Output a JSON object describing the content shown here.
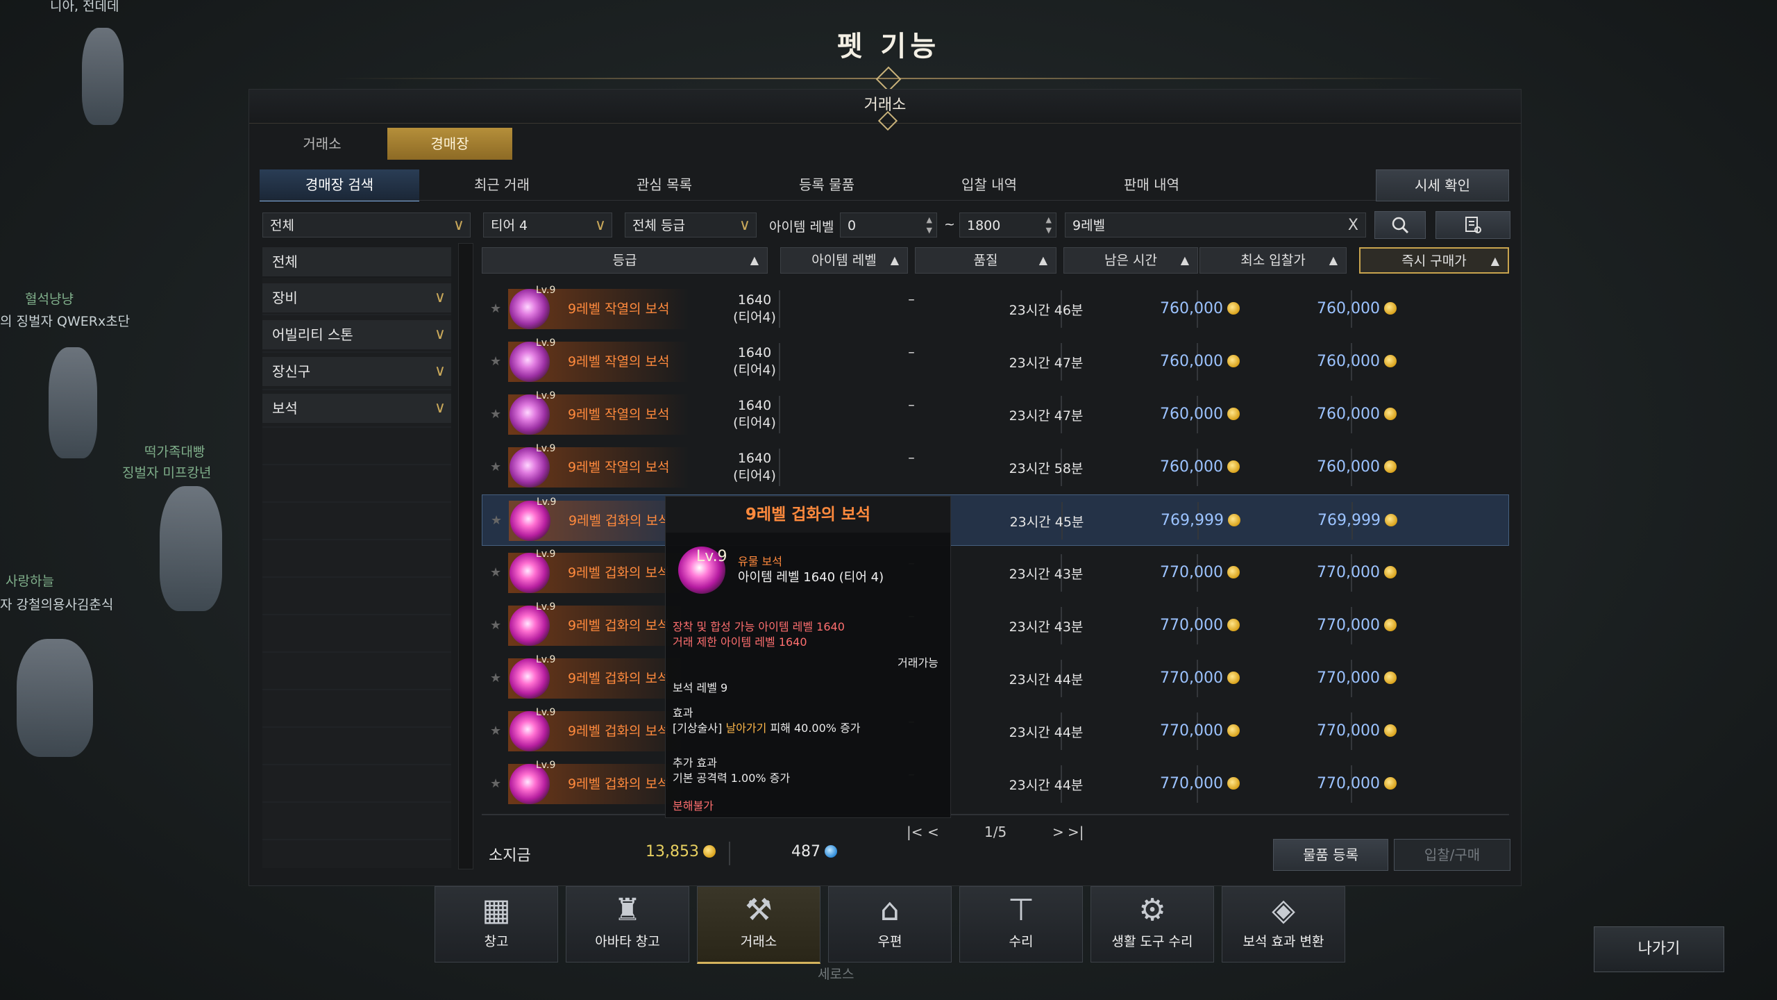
{
  "background": {
    "texts": [
      "니아, 전데데",
      "혈석냥냥",
      "의 징벌자 QWERx초단",
      "떡가족대빵",
      "징벌자 미프캉년",
      "사랑하늘",
      "자 강철의용사김춘식",
      "세로스"
    ]
  },
  "window": {
    "title": "펫 기능",
    "panel_title": "거래소"
  },
  "main_tabs": [
    {
      "label": "거래소",
      "active": false
    },
    {
      "label": "경매장",
      "active": true
    }
  ],
  "sub_tabs": [
    {
      "label": "경매장 검색",
      "active": true
    },
    {
      "label": "최근 거래",
      "active": false
    },
    {
      "label": "관심 목록",
      "active": false
    },
    {
      "label": "등록 물품",
      "active": false
    },
    {
      "label": "입찰 내역",
      "active": false
    },
    {
      "label": "판매 내역",
      "active": false
    }
  ],
  "price_check_label": "시세 확인",
  "filters": {
    "category": "전체",
    "tier": "티어 4",
    "grade": "전체 등급",
    "item_level_label": "아이템 레벨",
    "item_level_min": "0",
    "tilde": "~",
    "item_level_max": "1800",
    "search_text": "9레벨",
    "clear_icon": "X"
  },
  "categories": [
    {
      "label": "전체",
      "has_chevron": false
    },
    {
      "label": "장비",
      "has_chevron": true
    },
    {
      "label": "어빌리티 스톤",
      "has_chevron": true
    },
    {
      "label": "장신구",
      "has_chevron": true
    },
    {
      "label": "보석",
      "has_chevron": true
    }
  ],
  "columns": [
    {
      "label": "등급"
    },
    {
      "label": "아이템 레벨"
    },
    {
      "label": "품질"
    },
    {
      "label": "남은 시간"
    },
    {
      "label": "최소 입찰가"
    },
    {
      "label": "즉시 구매가",
      "selected": true
    }
  ],
  "rows": [
    {
      "lv": "Lv.9",
      "name": "9레벨 작열의 보석",
      "level": "1640",
      "tier": "(티어4)",
      "quality": "–",
      "time": "23시간 46분",
      "min_bid": "760,000",
      "buy_now": "760,000"
    },
    {
      "lv": "Lv.9",
      "name": "9레벨 작열의 보석",
      "level": "1640",
      "tier": "(티어4)",
      "quality": "–",
      "time": "23시간 47분",
      "min_bid": "760,000",
      "buy_now": "760,000"
    },
    {
      "lv": "Lv.9",
      "name": "9레벨 작열의 보석",
      "level": "1640",
      "tier": "(티어4)",
      "quality": "–",
      "time": "23시간 47분",
      "min_bid": "760,000",
      "buy_now": "760,000"
    },
    {
      "lv": "Lv.9",
      "name": "9레벨 작열의 보석",
      "level": "1640",
      "tier": "(티어4)",
      "quality": "–",
      "time": "23시간 58분",
      "min_bid": "760,000",
      "buy_now": "760,000"
    },
    {
      "lv": "Lv.9",
      "name": "9레벨 겁화의 보석",
      "level": "",
      "tier": "",
      "quality": "–",
      "time": "23시간 45분",
      "min_bid": "769,999",
      "buy_now": "769,999",
      "highlighted": true
    },
    {
      "lv": "Lv.9",
      "name": "9레벨 겁화의 보석",
      "level": "",
      "tier": "",
      "quality": "–",
      "time": "23시간 43분",
      "min_bid": "770,000",
      "buy_now": "770,000"
    },
    {
      "lv": "Lv.9",
      "name": "9레벨 겁화의 보석",
      "level": "",
      "tier": "",
      "quality": "–",
      "time": "23시간 43분",
      "min_bid": "770,000",
      "buy_now": "770,000"
    },
    {
      "lv": "Lv.9",
      "name": "9레벨 겁화의 보석",
      "level": "",
      "tier": "",
      "quality": "–",
      "time": "23시간 44분",
      "min_bid": "770,000",
      "buy_now": "770,000"
    },
    {
      "lv": "Lv.9",
      "name": "9레벨 겁화의 보석",
      "level": "",
      "tier": "",
      "quality": "–",
      "time": "23시간 44분",
      "min_bid": "770,000",
      "buy_now": "770,000"
    },
    {
      "lv": "Lv.9",
      "name": "9레벨 겁화의 보석",
      "level": "",
      "tier": "",
      "quality": "–",
      "time": "23시간 44분",
      "min_bid": "770,000",
      "buy_now": "770,000"
    }
  ],
  "tooltip": {
    "title": "9레벨 겁화의 보석",
    "lv": "Lv.9",
    "rarity": "유물 보석",
    "item_level": "아이템 레벨 1640 (티어 4)",
    "equip_req": "장착 및 합성 가능 아이템 레벨 1640",
    "trade_req": "거래 제한 아이템 레벨 1640",
    "tradable": "거래가능",
    "gem_level": "보석 레벨 9",
    "effect_label": "효과",
    "effect_prefix": "[기상술사]",
    "effect_skill": "날아가기",
    "effect_rest": "피해 40.00% 증가",
    "extra_label": "추가 효과",
    "extra_text": "기본 공격력 1.00% 증가",
    "disassemble": "분해불가"
  },
  "pagination": {
    "first": "|<",
    "prev": "<",
    "page": "1/5",
    "next": ">",
    "last": ">|"
  },
  "wallet": {
    "label": "소지금",
    "gold": "13,853",
    "silver": "487"
  },
  "actions": {
    "register": "물품 등록",
    "bid_buy": "입찰/구매"
  },
  "dock": [
    {
      "label": "창고",
      "icon": "storage-icon"
    },
    {
      "label": "아바타 창고",
      "icon": "avatar-storage-icon"
    },
    {
      "label": "거래소",
      "icon": "gavel-icon",
      "active": true
    },
    {
      "label": "우편",
      "icon": "mail-icon"
    },
    {
      "label": "수리",
      "icon": "anvil-icon"
    },
    {
      "label": "생활 도구 수리",
      "icon": "tool-repair-icon"
    },
    {
      "label": "보석 효과 변환",
      "icon": "gem-convert-icon"
    }
  ],
  "exit_label": "나가기",
  "colors": {
    "accent_gold": "#c9a44e",
    "price_blue": "#9cc3ff",
    "item_orange": "#ff8a3d",
    "highlight_row": "#243247"
  }
}
